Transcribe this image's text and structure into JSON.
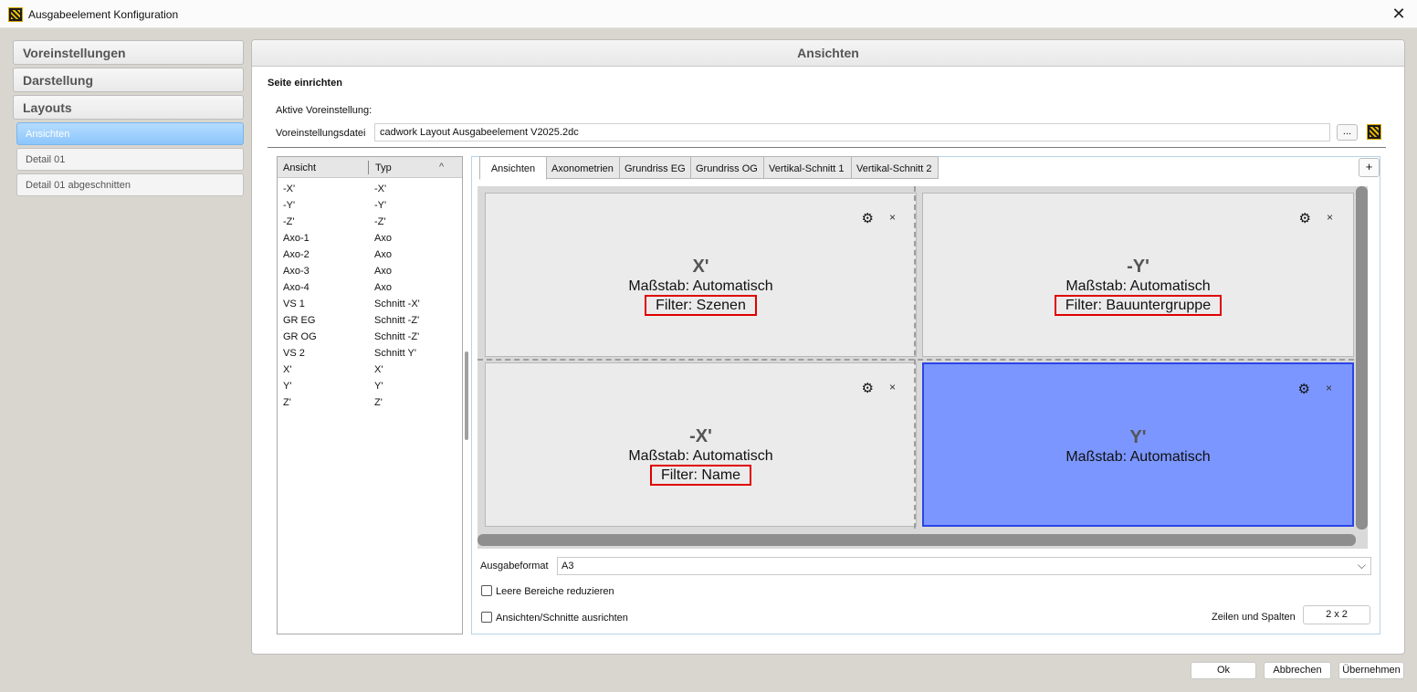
{
  "window": {
    "title": "Ausgabeelement Konfiguration",
    "close_glyph": "✕"
  },
  "left_nav": {
    "sections": [
      "Voreinstellungen",
      "Darstellung",
      "Layouts"
    ],
    "subitems": [
      "Ansichten",
      "Detail 01",
      "Detail 01 abgeschnitten"
    ],
    "active_subitem": "Ansichten"
  },
  "main": {
    "header": "Ansichten",
    "section_title": "Seite einrichten",
    "active_preset_label": "Aktive Voreinstellung:",
    "preset_file_label": "Voreinstellungsdatei",
    "preset_file_value": "cadwork Layout Ausgabeelement V2025.2dc",
    "browse_label": "...",
    "list": {
      "col1": "Ansicht",
      "col2": "Typ",
      "sort_glyph": "^",
      "rows": [
        {
          "ansicht": "-X'",
          "typ": "-X'"
        },
        {
          "ansicht": "-Y'",
          "typ": "-Y'"
        },
        {
          "ansicht": "-Z'",
          "typ": "-Z'"
        },
        {
          "ansicht": "Axo-1",
          "typ": "Axo"
        },
        {
          "ansicht": "Axo-2",
          "typ": "Axo"
        },
        {
          "ansicht": "Axo-3",
          "typ": "Axo"
        },
        {
          "ansicht": "Axo-4",
          "typ": "Axo"
        },
        {
          "ansicht": "VS 1",
          "typ": "Schnitt -X'"
        },
        {
          "ansicht": "GR EG",
          "typ": "Schnitt -Z'"
        },
        {
          "ansicht": "GR OG",
          "typ": "Schnitt -Z'"
        },
        {
          "ansicht": "VS 2",
          "typ": "Schnitt Y'"
        },
        {
          "ansicht": "X'",
          "typ": "X'"
        },
        {
          "ansicht": "Y'",
          "typ": "Y'"
        },
        {
          "ansicht": "Z'",
          "typ": "Z'"
        }
      ]
    },
    "tabs": [
      "Ansichten",
      "Axonometrien",
      "Grundriss EG",
      "Grundriss OG",
      "Vertikal-Schnitt 1",
      "Vertikal-Schnitt 2"
    ],
    "active_tab": "Ansichten",
    "add_tab_label": "+",
    "cells": [
      {
        "name": "X'",
        "scale": "Maßstab: Automatisch",
        "filter": "Filter: Szenen",
        "selected": false
      },
      {
        "name": "-Y'",
        "scale": "Maßstab: Automatisch",
        "filter": "Filter: Bauuntergruppe",
        "selected": false
      },
      {
        "name": "-X'",
        "scale": "Maßstab: Automatisch",
        "filter": "Filter: Name",
        "selected": false
      },
      {
        "name": "Y'",
        "scale": "Maßstab: Automatisch",
        "filter": "",
        "selected": true
      }
    ],
    "cell_gear_glyph": "⚙",
    "cell_close_glyph": "×",
    "output_format_label": "Ausgabeformat",
    "output_format_value": "A3",
    "select_chevron": "⌵",
    "checkbox_reduce": "Leere Bereiche reduzieren",
    "checkbox_align": "Ansichten/Schnitte ausrichten",
    "rows_cols_label": "Zeilen und Spalten",
    "rows_cols_value": "2 x 2"
  },
  "footer": {
    "ok": "Ok",
    "cancel": "Abbrechen",
    "apply": "Übernehmen"
  },
  "colors": {
    "selected_cell": "#7b96ff",
    "filter_highlight": "#e00000",
    "active_subitem": "#8cc6fb"
  },
  "icons": {
    "gear": "gear-icon",
    "close": "close-icon",
    "app": "cadwork-app-icon"
  }
}
